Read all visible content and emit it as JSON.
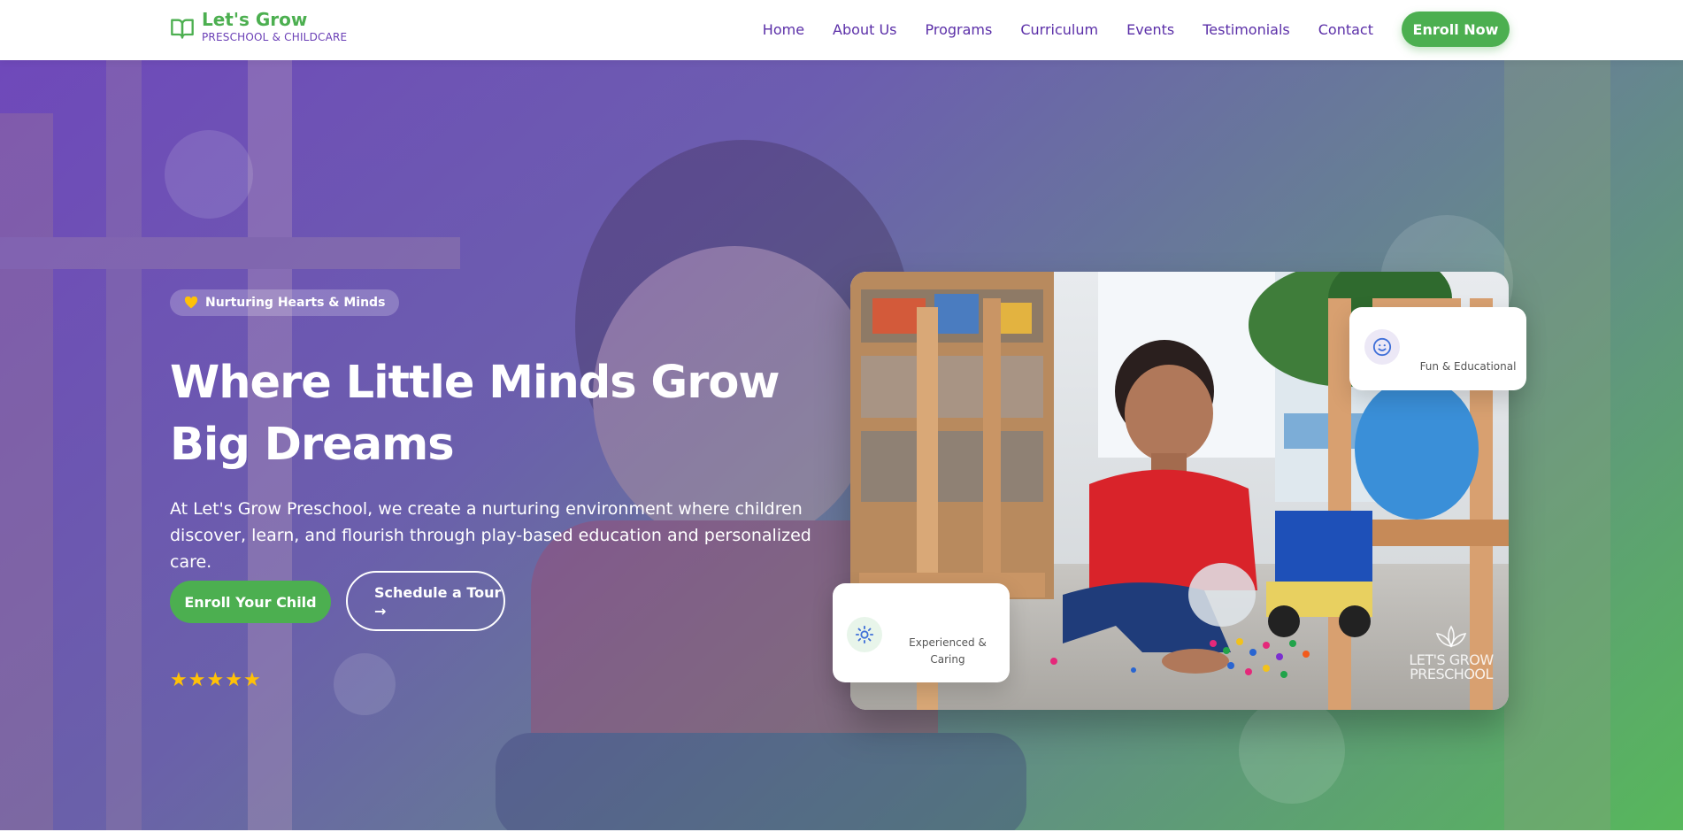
{
  "brand": {
    "name": "Let's Grow",
    "tagline": "PRESCHOOL & CHILDCARE",
    "logo_icon": "open-book-icon",
    "primary_color": "#4caf50",
    "accent_color": "#5b2fa8"
  },
  "nav": {
    "links": [
      {
        "label": "Home"
      },
      {
        "label": "About Us"
      },
      {
        "label": "Programs"
      },
      {
        "label": "Curriculum"
      },
      {
        "label": "Events"
      },
      {
        "label": "Testimonials"
      },
      {
        "label": "Contact"
      }
    ],
    "cta_label": "Enroll Now"
  },
  "hero": {
    "badge": {
      "icon": "heart-icon",
      "label": "Nurturing Hearts & Minds"
    },
    "headline": "Where Little Minds Grow Big Dreams",
    "subtext": "At Let's Grow Preschool, we create a nurturing environment where children discover, learn, and flourish through play-based education and personalized care.",
    "primary_button": "Enroll Your Child",
    "secondary_button": "Schedule a Tour",
    "secondary_button_icon": "arrow-right-icon",
    "rating_stars": 5,
    "gradient_start": "#6e46be",
    "gradient_end": "#55be5a"
  },
  "photo": {
    "watermark": "LET'S GROW PRESCHOOL"
  },
  "feature_cards": [
    {
      "icon": "smile-icon",
      "label": "Fun & Educational"
    },
    {
      "icon": "sun-icon",
      "label": "Experienced & Caring"
    }
  ]
}
